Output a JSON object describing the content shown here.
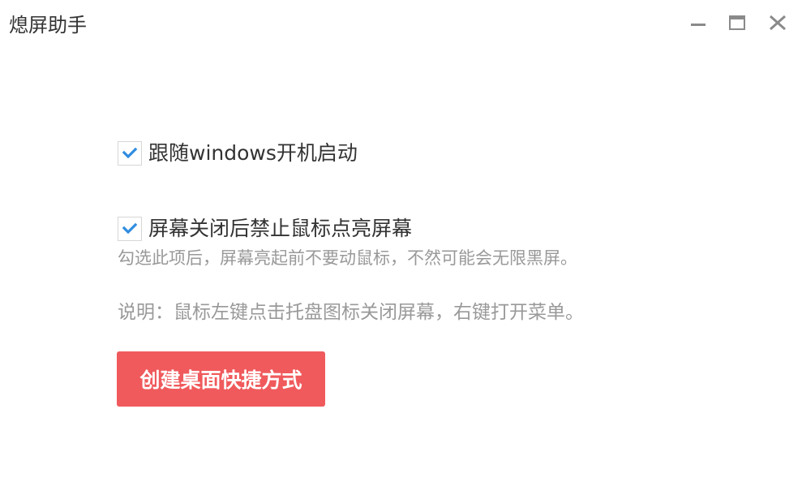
{
  "window": {
    "title": "熄屏助手",
    "controls": [
      "minimize-icon",
      "maximize-icon",
      "close-icon"
    ]
  },
  "options": [
    {
      "label": "跟随windows开机启动",
      "checked": true
    },
    {
      "label": "屏幕关闭后禁止鼠标点亮屏幕",
      "checked": true
    }
  ],
  "hint": "勾选此项后，屏幕亮起前不要动鼠标，不然可能会无限黑屏。",
  "note": "说明：鼠标左键点击托盘图标关闭屏幕，右键打开菜单。",
  "create_button": {
    "label": "创建桌面快捷方式"
  },
  "colors": {
    "accent_check": "#2f8ce0",
    "button_bg": "#f05a5c",
    "muted_text": "#999999",
    "control_icon": "#8a8a8a"
  }
}
